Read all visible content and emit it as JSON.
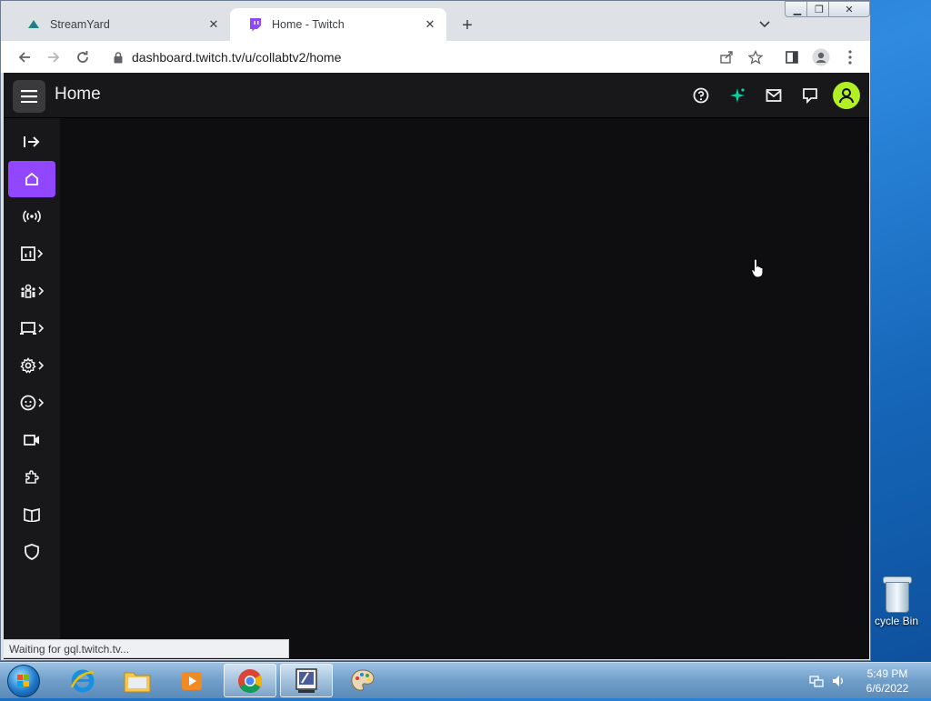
{
  "browser": {
    "tabs": [
      {
        "title": "StreamYard",
        "active": false
      },
      {
        "title": "Home - Twitch",
        "active": true
      }
    ],
    "url": "dashboard.twitch.tv/u/collabtv2/home",
    "status_text": "Waiting for gql.twitch.tv..."
  },
  "twitch": {
    "page_title": "Home",
    "accent_color": "#9147ff",
    "avatar_color": "#b0f025",
    "sidebar_items": [
      {
        "icon": "collapse-icon",
        "has_submenu": false,
        "active": false
      },
      {
        "icon": "home-icon",
        "has_submenu": false,
        "active": true
      },
      {
        "icon": "stream-icon",
        "has_submenu": false,
        "active": false
      },
      {
        "icon": "analytics-icon",
        "has_submenu": true,
        "active": false
      },
      {
        "icon": "community-icon",
        "has_submenu": true,
        "active": false
      },
      {
        "icon": "content-icon",
        "has_submenu": true,
        "active": false
      },
      {
        "icon": "settings-icon",
        "has_submenu": true,
        "active": false
      },
      {
        "icon": "viewer-rewards-icon",
        "has_submenu": true,
        "active": false
      },
      {
        "icon": "creator-camp-video-icon",
        "has_submenu": false,
        "active": false
      },
      {
        "icon": "extensions-icon",
        "has_submenu": false,
        "active": false
      },
      {
        "icon": "learn-icon",
        "has_submenu": false,
        "active": false
      },
      {
        "icon": "safety-icon",
        "has_submenu": false,
        "active": false
      }
    ]
  },
  "desktop": {
    "recycle_bin_label": "cycle Bin"
  },
  "taskbar": {
    "time": "5:49 PM",
    "date": "6/6/2022"
  }
}
